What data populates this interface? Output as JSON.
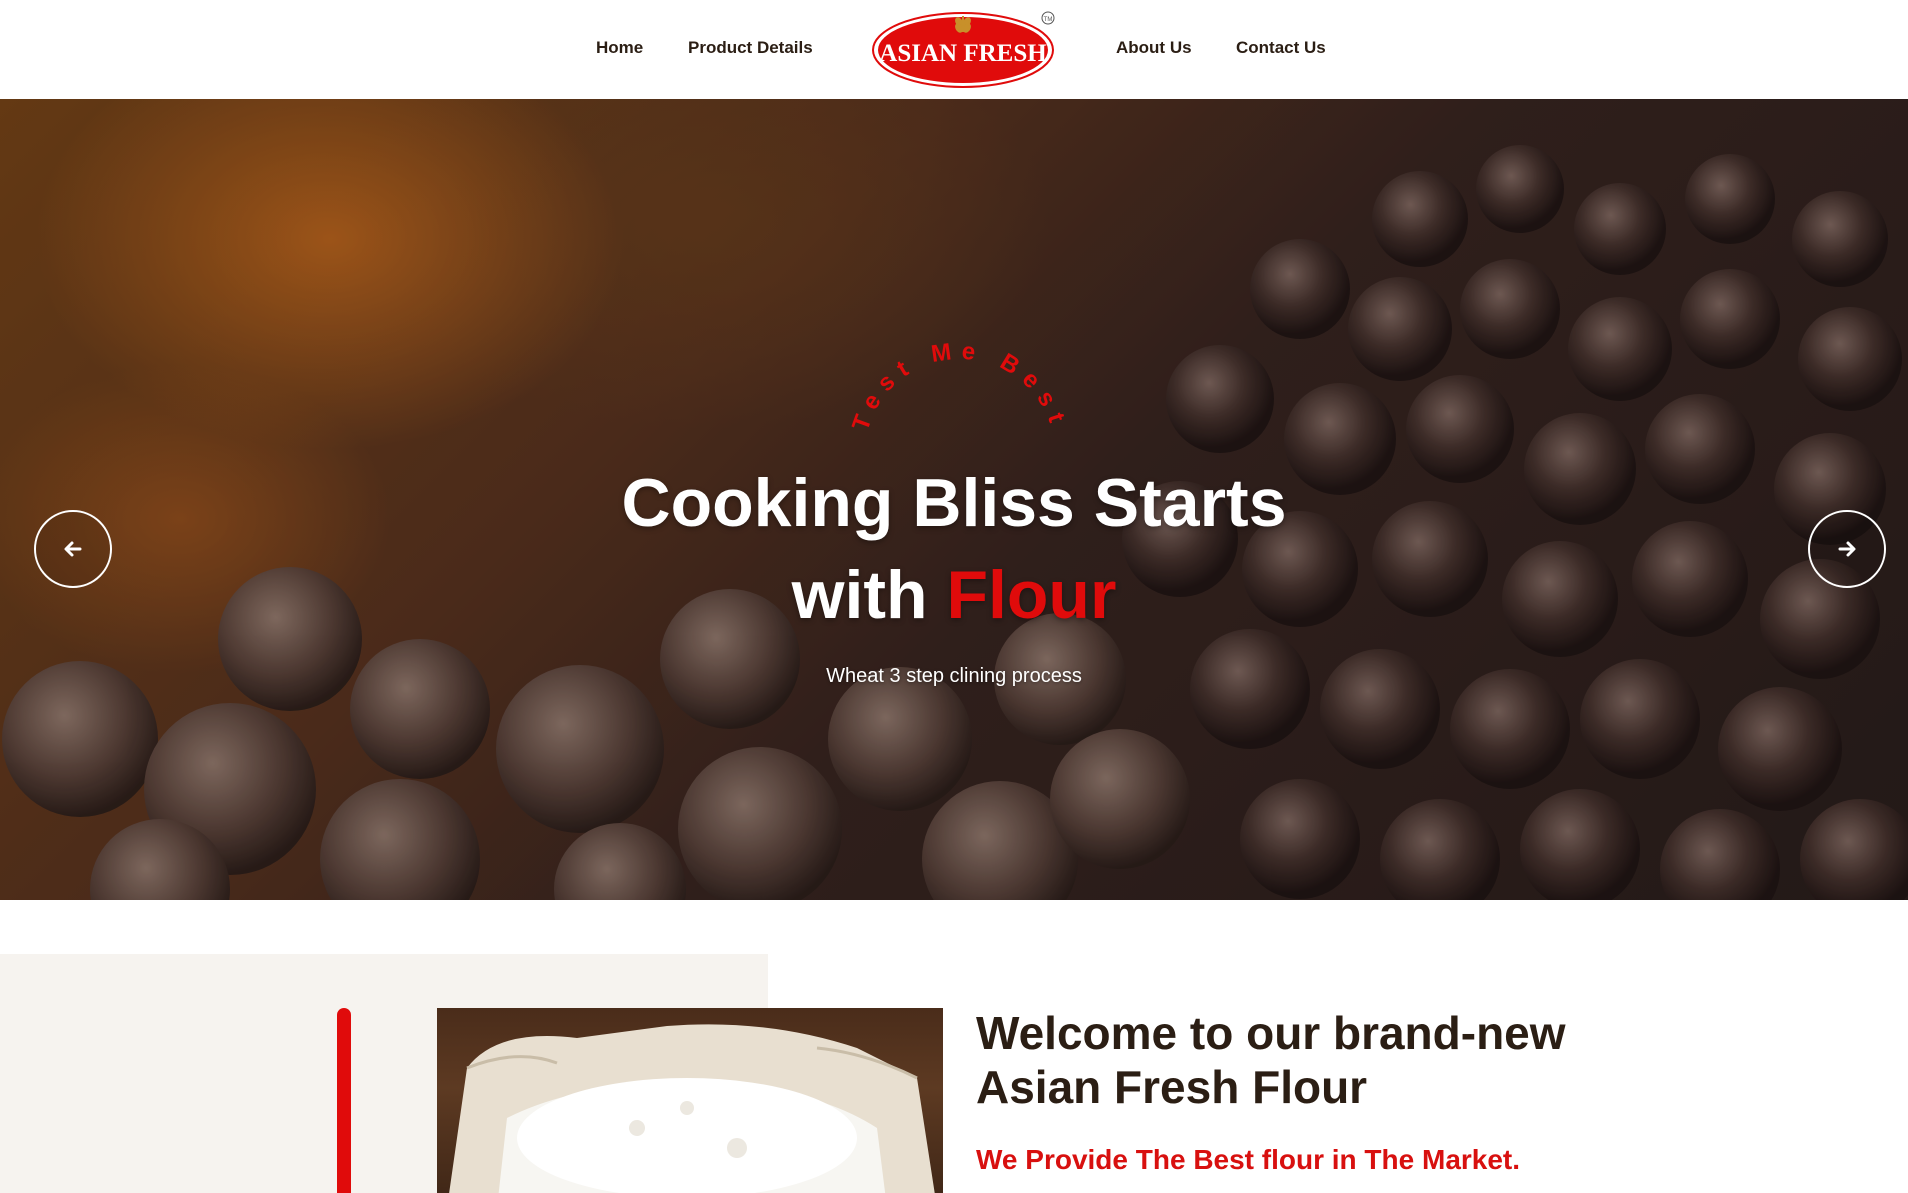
{
  "nav": {
    "home": "Home",
    "product_details": "Product Details",
    "about_us": "About Us",
    "contact_us": "Contact Us"
  },
  "logo": {
    "text": "ASIAN FRESH",
    "trademark": "TM",
    "color": "#e00b0b"
  },
  "hero": {
    "tagline": "Test Me Best",
    "title_line1": "Cooking Bliss Starts",
    "title_line2_prefix": "with ",
    "title_line2_accent": "Flour",
    "subtitle": "Wheat 3 step clining process",
    "prev_icon": "arrow-left-icon",
    "next_icon": "arrow-right-icon"
  },
  "welcome": {
    "title_line1": "Welcome to our brand-new",
    "title_line2": "Asian Fresh Flour",
    "subtitle": "We Provide The Best flour in The Market."
  },
  "colors": {
    "accent": "#e00b0b",
    "text_dark": "#2b1e14",
    "section_bg": "#f6f3ef"
  }
}
